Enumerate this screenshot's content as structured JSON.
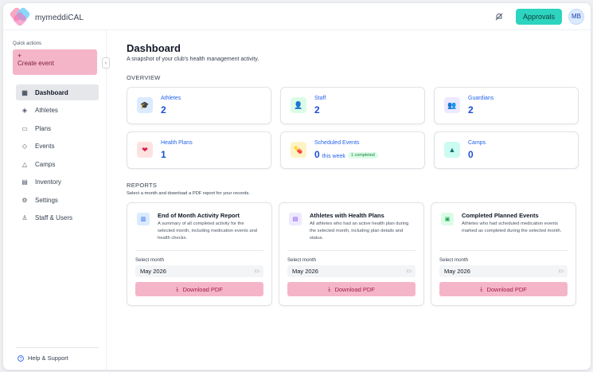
{
  "app": {
    "name": "mymeddiCAL"
  },
  "header": {
    "approvals_label": "Approvals",
    "avatar_initials": "MB"
  },
  "sidebar": {
    "quick_actions_label": "Quick actions",
    "create_plus": "+",
    "create_event_label": "Create event",
    "collapse_glyph": "‹",
    "items": [
      {
        "label": "Dashboard",
        "icon": "grid-icon",
        "glyph": "▦",
        "active": true
      },
      {
        "label": "Athletes",
        "icon": "graduation-cap-icon",
        "glyph": "◈"
      },
      {
        "label": "Plans",
        "icon": "calendar-icon",
        "glyph": "▭"
      },
      {
        "label": "Events",
        "icon": "pill-icon",
        "glyph": "◇"
      },
      {
        "label": "Camps",
        "icon": "tent-icon",
        "glyph": "△"
      },
      {
        "label": "Inventory",
        "icon": "archive-icon",
        "glyph": "▤"
      },
      {
        "label": "Settings",
        "icon": "gear-icon",
        "glyph": "⚙"
      },
      {
        "label": "Staff & Users",
        "icon": "user-icon",
        "glyph": "♙"
      }
    ],
    "help_label": "Help & Support"
  },
  "page": {
    "title": "Dashboard",
    "subtitle": "A snapshot of your club's health management activity.",
    "overview_label": "OVERVIEW",
    "reports_label": "REPORTS",
    "reports_subtitle": "Select a month and download a PDF report for your records."
  },
  "stats": [
    {
      "label": "Athletes",
      "value": "2",
      "icon": "graduation-cap-icon",
      "glyph": "🎓",
      "bg": "#dbeafe",
      "fg": "#2563eb"
    },
    {
      "label": "Staff",
      "value": "2",
      "icon": "user-icon",
      "glyph": "👤",
      "bg": "#dcfce7",
      "fg": "#16a34a"
    },
    {
      "label": "Guardians",
      "value": "2",
      "icon": "users-icon",
      "glyph": "👥",
      "bg": "#ede9fe",
      "fg": "#7c3aed"
    },
    {
      "label": "Health Plans",
      "value": "1",
      "icon": "heart-pulse-icon",
      "glyph": "❤",
      "bg": "#fee2e2",
      "fg": "#e11d48"
    },
    {
      "label": "Scheduled Events",
      "value": "0",
      "extra": "this week",
      "badge": "1 completed",
      "icon": "pill-icon",
      "glyph": "💊",
      "bg": "#fef3c7",
      "fg": "#d97706"
    },
    {
      "label": "Camps",
      "value": "0",
      "icon": "tent-icon",
      "glyph": "▲",
      "bg": "#ccfbf1",
      "fg": "#0f766e"
    }
  ],
  "reports": [
    {
      "title": "End of Month Activity Report",
      "description": "A summary of all completed activity for the selected month, including medication events and health checks.",
      "icon": "chart-icon",
      "glyph": "▥",
      "bg": "#dbeafe",
      "fg": "#2563eb",
      "month_label": "Select month",
      "month_value": "May 2026",
      "download_label": "Download PDF"
    },
    {
      "title": "Athletes with Health Plans",
      "description": "All athletes who had an active health plan during the selected month, including plan details and status.",
      "icon": "document-icon",
      "glyph": "▤",
      "bg": "#ede9fe",
      "fg": "#7c3aed",
      "month_label": "Select month",
      "month_value": "May 2026",
      "download_label": "Download PDF"
    },
    {
      "title": "Completed Planned Events",
      "description": "Athletes who had scheduled medication events marked as completed during the selected month.",
      "icon": "calendar-check-icon",
      "glyph": "▣",
      "bg": "#dcfce7",
      "fg": "#16a34a",
      "month_label": "Select month",
      "month_value": "May 2026",
      "download_label": "Download PDF"
    }
  ]
}
